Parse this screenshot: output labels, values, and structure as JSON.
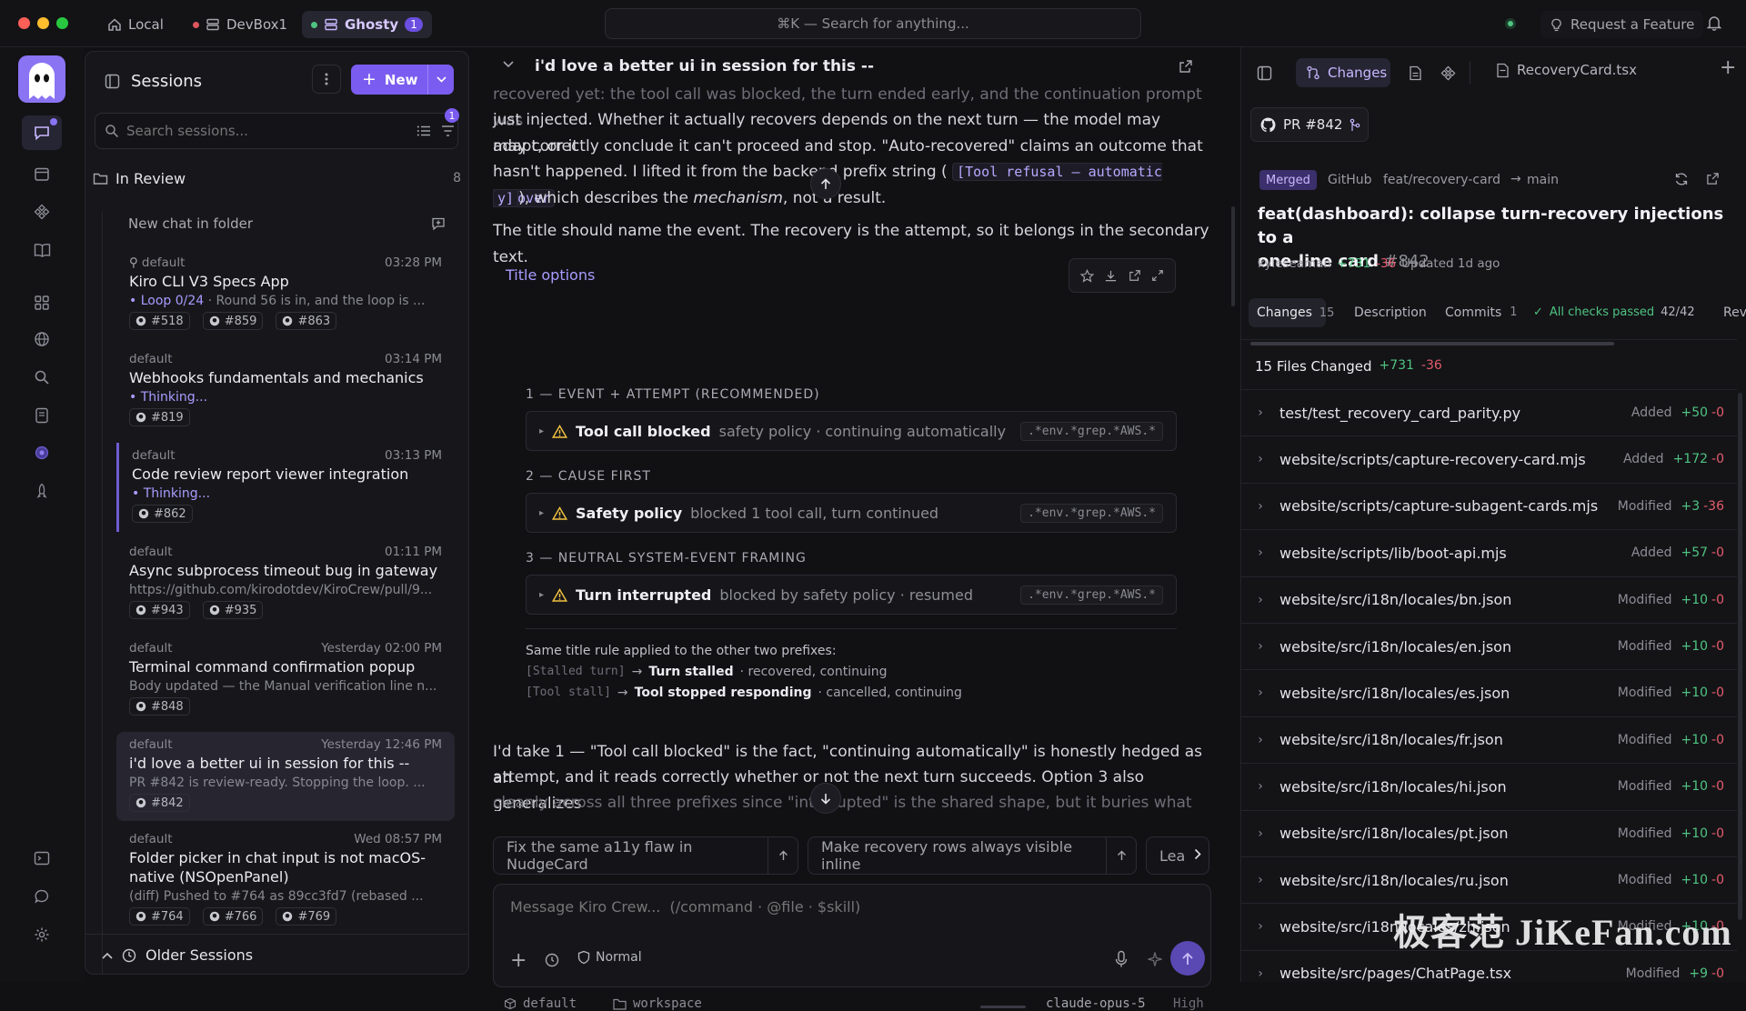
{
  "titlebar": {
    "tabs": [
      {
        "label": "Local"
      },
      {
        "label": "DevBox1"
      },
      {
        "label": "Ghosty",
        "badge": "1"
      }
    ],
    "search": "⌘K — Search for anything...",
    "feature": "Request a Feature"
  },
  "colors": {
    "accent": "#7b5cf0",
    "green": "#4fc381",
    "red": "#e45c6c",
    "merged": "#9b7bff"
  },
  "sessions": {
    "title": "Sessions",
    "new_label": "New",
    "search_placeholder": "Search sessions...",
    "filter_badge": "1",
    "folder": {
      "label": "In Review",
      "count": "8"
    },
    "new_chat": "New chat in folder",
    "items": [
      {
        "folder": "default",
        "time": "03:28 PM",
        "title": "Kiro CLI V3 Specs App",
        "sub_prefix": "Loop 0/24",
        "sub": " · Round 56 is in, and the loop is ...",
        "prs": [
          "#518",
          "#859",
          "#863"
        ]
      },
      {
        "folder": "default",
        "time": "03:14 PM",
        "title": "Webhooks fundamentals and mechanics",
        "sub_prefix": "Thinking...",
        "sub": "",
        "prs": [
          "#819"
        ]
      },
      {
        "folder": "default",
        "time": "03:13 PM",
        "title": "Code review report viewer integration",
        "sub_prefix": "Thinking...",
        "sub": "",
        "prs": [
          "#862"
        ]
      },
      {
        "folder": "default",
        "time": "01:11 PM",
        "title": "Async subprocess timeout bug in gateway",
        "sub_prefix": "",
        "sub": "https://github.com/kirodotdev/KiroCrew/pull/9...",
        "prs": [
          "#943",
          "#935"
        ]
      },
      {
        "folder": "default",
        "time": "Yesterday 02:00 PM",
        "title": "Terminal command confirmation popup",
        "sub_prefix": "",
        "sub": "Body updated — the Manual verification line n...",
        "prs": [
          "#848"
        ]
      },
      {
        "folder": "default",
        "time": "Yesterday 12:46 PM",
        "title": "i'd love a better ui in session for this --",
        "sub_prefix": "",
        "sub": "PR #842 is review-ready. Stopping the loop. ...",
        "prs": [
          "#842"
        ]
      },
      {
        "folder": "default",
        "time": "Wed 08:57 PM",
        "title": "Folder picker in chat input is not macOS-native (NSOpenPanel)",
        "sub_prefix": "",
        "sub": "(diff) Pushed to #764 as 89cc3fd7 (rebased ...",
        "prs": [
          "#764",
          "#766",
          "#769"
        ]
      }
    ],
    "older": "Older Sessions"
  },
  "chat": {
    "title": "i'd love a better ui in session for this --",
    "p0": "recovered yet: the tool call was blocked, the turn ended early, and the continuation prompt was",
    "p1": "just injected. Whether it actually recovers depends on the next turn — the model may adapt, or it",
    "p2": "may correctly conclude it can't proceed and stop. \"Auto-recovered\" claims an outcome that",
    "p3a": "hasn't happened. I lifted it from the backend prefix string (",
    "p3code": "[Tool refusal — automatic recover",
    "p4code": "y]",
    "p4b": "), which describes the ",
    "p4i": "mechanism",
    "p4c": ", not a result.",
    "p5": "The title should name the event. The recovery is the attempt, so it belongs in the secondary text.",
    "title_options": "Title options",
    "options": [
      {
        "head": "1 — EVENT + ATTEMPT (RECOMMENDED)",
        "bold": "Tool call blocked",
        "desc": "safety policy · continuing automatically",
        "grep": ".*env.*grep.*AWS.*"
      },
      {
        "head": "2 — CAUSE FIRST",
        "bold": "Safety policy",
        "desc": "blocked 1 tool call, turn continued",
        "grep": ".*env.*grep.*AWS.*"
      },
      {
        "head": "3 — NEUTRAL SYSTEM-EVENT FRAMING",
        "bold": "Turn interrupted",
        "desc": "blocked by safety policy · resumed",
        "grep": ".*env.*grep.*AWS.*"
      }
    ],
    "rule": "Same title rule applied to the other two prefixes:",
    "rule1": {
      "code": "[Stalled turn]",
      "bold": "Turn stalled",
      "rest": "· recovered, continuing"
    },
    "rule2": {
      "code": "[Tool stall]",
      "bold": "Tool stopped responding",
      "rest": "· cancelled, continuing"
    },
    "q1": "I'd take 1 — \"Tool call blocked\" is the fact, \"continuing automatically\" is honestly hedged as an",
    "q2": "attempt, and it reads correctly whether or not the next turn succeeds. Option 3 also generalizes",
    "q3": "cleanly across all three prefixes since \"interrupted\" is the shared shape, but it buries what",
    "chips": [
      "Fix the same a11y flaw in NudgeCard",
      "Make recovery rows always visible inline",
      "Lea"
    ],
    "input_placeholder": "Message Kiro Crew...  (/command · @file · $skill)",
    "mode": "Normal",
    "footer": {
      "branch": "default",
      "folder": "workspace",
      "model": "claude-opus-5",
      "effort": "High"
    }
  },
  "right": {
    "tabs": {
      "changes": "Changes",
      "file": "RecoveryCard.tsx"
    },
    "pr": "PR #842",
    "merged": "Merged",
    "provider": "GitHub",
    "branch": "feat/recovery-card",
    "base": "main",
    "title_l1": "feat(dashboard): collapse turn-recovery injections to a",
    "title_l2": "one-line card",
    "num": "#842",
    "author": "kyleseaman",
    "adds": "+731",
    "dels": "-36",
    "updated": "Updated 1d ago",
    "subtabs": {
      "changes": "Changes",
      "changes_count": "15",
      "description": "Description",
      "commits": "Commits",
      "commits_count": "1",
      "checks": "All checks passed",
      "checks_count": "42/42",
      "rev": "Rev"
    },
    "files_changed": "15 Files Changed",
    "files": [
      {
        "name": "test/test_recovery_card_parity.py",
        "status": "Added",
        "add": "+50",
        "del": "-0"
      },
      {
        "name": "website/scripts/capture-recovery-card.mjs",
        "status": "Added",
        "add": "+172",
        "del": "-0"
      },
      {
        "name": "website/scripts/capture-subagent-cards.mjs",
        "status": "Modified",
        "add": "+3",
        "del": "-36"
      },
      {
        "name": "website/scripts/lib/boot-api.mjs",
        "status": "Added",
        "add": "+57",
        "del": "-0"
      },
      {
        "name": "website/src/i18n/locales/bn.json",
        "status": "Modified",
        "add": "+10",
        "del": "-0"
      },
      {
        "name": "website/src/i18n/locales/en.json",
        "status": "Modified",
        "add": "+10",
        "del": "-0"
      },
      {
        "name": "website/src/i18n/locales/es.json",
        "status": "Modified",
        "add": "+10",
        "del": "-0"
      },
      {
        "name": "website/src/i18n/locales/fr.json",
        "status": "Modified",
        "add": "+10",
        "del": "-0"
      },
      {
        "name": "website/src/i18n/locales/hi.json",
        "status": "Modified",
        "add": "+10",
        "del": "-0"
      },
      {
        "name": "website/src/i18n/locales/pt.json",
        "status": "Modified",
        "add": "+10",
        "del": "-0"
      },
      {
        "name": "website/src/i18n/locales/ru.json",
        "status": "Modified",
        "add": "+10",
        "del": "-0"
      },
      {
        "name": "website/src/i18n/locales/zh.json",
        "status": "Modified",
        "add": "+10",
        "del": "-0"
      },
      {
        "name": "website/src/pages/ChatPage.tsx",
        "status": "Modified",
        "add": "+9",
        "del": "-0"
      }
    ]
  },
  "watermark": "极客范 JiKeFan.com"
}
